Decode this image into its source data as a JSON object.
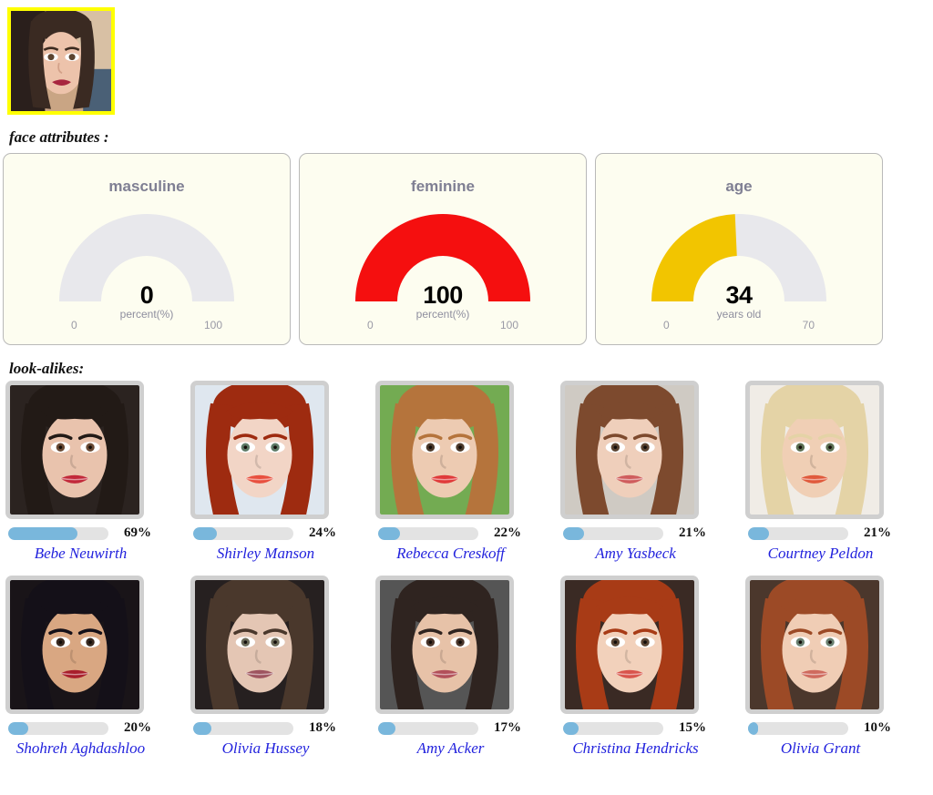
{
  "query_photo": {
    "name": "query-face-photo",
    "border_color": "#ffff00",
    "alt": "uploaded face photo"
  },
  "headings": {
    "face_attributes": "face attributes :",
    "lookalikes": "look-alikes:"
  },
  "chart_data": [
    {
      "type": "gauge",
      "title": "masculine",
      "value": 0,
      "display_value": "0",
      "unit": "percent(%)",
      "min": 0,
      "max": 100,
      "min_label": "0",
      "max_label": "100",
      "fill_color": "#e8e8ec",
      "track_color": "#e8e8ec",
      "fill_fraction": 0.0
    },
    {
      "type": "gauge",
      "title": "feminine",
      "value": 100,
      "display_value": "100",
      "unit": "percent(%)",
      "min": 0,
      "max": 100,
      "min_label": "0",
      "max_label": "100",
      "fill_color": "#f50f0f",
      "track_color": "#e8e8ec",
      "fill_fraction": 1.0
    },
    {
      "type": "gauge",
      "title": "age",
      "value": 34,
      "display_value": "34",
      "unit": "years old",
      "min": 0,
      "max": 70,
      "min_label": "0",
      "max_label": "70",
      "fill_color": "#f2c500",
      "track_color": "#e8e8ec",
      "fill_fraction": 0.4857
    }
  ],
  "lookalikes": [
    {
      "name": "Bebe Neuwirth",
      "percent": 69,
      "percent_label": "69%",
      "skin": "#e9c3ad",
      "hair": "#221a16",
      "bg": "#2b2320",
      "lip": "#c2293a",
      "eye": "#6a4a34"
    },
    {
      "name": "Shirley Manson",
      "percent": 24,
      "percent_label": "24%",
      "skin": "#f2d5c6",
      "hair": "#9e2b10",
      "bg": "#dfe7ef",
      "lip": "#e8503f",
      "eye": "#5d7a66"
    },
    {
      "name": "Rebecca Creskoff",
      "percent": 22,
      "percent_label": "22%",
      "skin": "#edcbb2",
      "hair": "#b5743c",
      "bg": "#73ab52",
      "lip": "#e03a3a",
      "eye": "#4d3a2a"
    },
    {
      "name": "Amy Yasbeck",
      "percent": 21,
      "percent_label": "21%",
      "skin": "#efcfbb",
      "hair": "#7d4a2e",
      "bg": "#cfcac3",
      "lip": "#cf5d5d",
      "eye": "#5a4330"
    },
    {
      "name": "Courtney Peldon",
      "percent": 21,
      "percent_label": "21%",
      "skin": "#f0cfb5",
      "hair": "#e4d3a6",
      "bg": "#f0ece6",
      "lip": "#e05a3c",
      "eye": "#5c6f52"
    },
    {
      "name": "Shohreh Aghdashloo",
      "percent": 20,
      "percent_label": "20%",
      "skin": "#d9a782",
      "hair": "#141018",
      "bg": "#191418",
      "lip": "#a81f2c",
      "eye": "#3a2a20"
    },
    {
      "name": "Olivia Hussey",
      "percent": 18,
      "percent_label": "18%",
      "skin": "#e4c6b4",
      "hair": "#4a382c",
      "bg": "#262020",
      "lip": "#9e5560",
      "eye": "#6b6a58"
    },
    {
      "name": "Amy Acker",
      "percent": 17,
      "percent_label": "17%",
      "skin": "#e7c2a8",
      "hair": "#2f2420",
      "bg": "#555555",
      "lip": "#b2505a",
      "eye": "#4a352a"
    },
    {
      "name": "Christina Hendricks",
      "percent": 15,
      "percent_label": "15%",
      "skin": "#f2d1bb",
      "hair": "#a83b16",
      "bg": "#3a2a24",
      "lip": "#d9554d",
      "eye": "#5b4634"
    },
    {
      "name": "Olivia Grant",
      "percent": 10,
      "percent_label": "10%",
      "skin": "#f0cdb5",
      "hair": "#9c4a26",
      "bg": "#4b372c",
      "lip": "#cf6a5e",
      "eye": "#6a8070"
    }
  ],
  "colors": {
    "name_link": "#2222dd",
    "bar_fill": "#79b7dc",
    "bar_track": "#e3e3e3",
    "panel_bg": "#fdfdf0",
    "panel_border": "#b9b9b9",
    "thumb_border": "#cfcfcf"
  }
}
